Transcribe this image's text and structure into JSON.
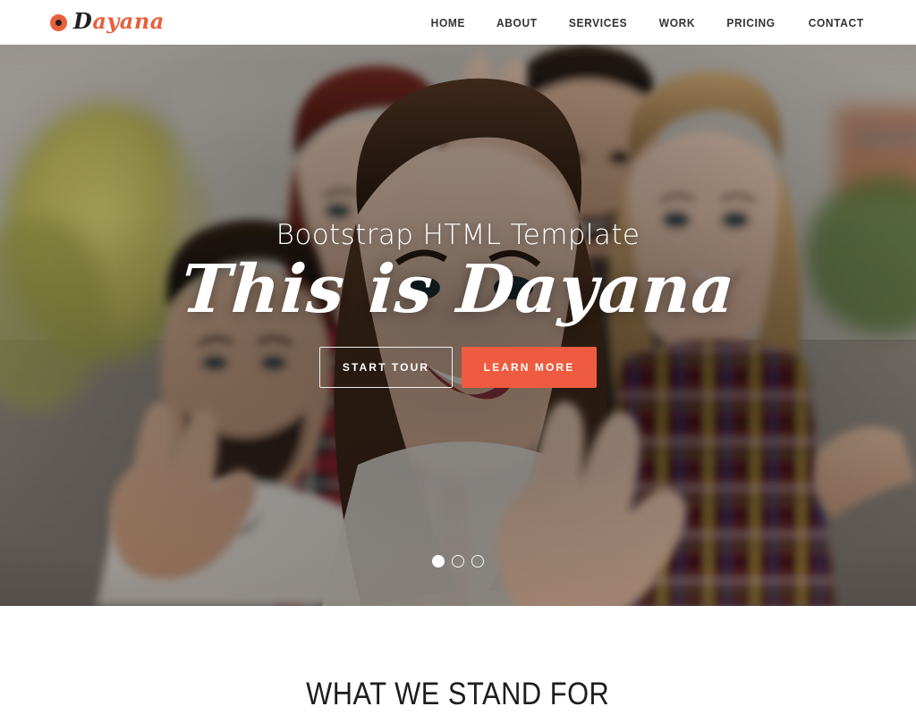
{
  "header": {
    "brand": {
      "mark_icon": "circle-dot-icon",
      "initial": "D",
      "rest": "ayana",
      "full_text": "Dayana"
    },
    "nav": {
      "items": [
        {
          "label": "HOME",
          "name": "nav-item-home"
        },
        {
          "label": "ABOUT",
          "name": "nav-item-about"
        },
        {
          "label": "SERVICES",
          "name": "nav-item-services"
        },
        {
          "label": "WORK",
          "name": "nav-item-work"
        },
        {
          "label": "PRICING",
          "name": "nav-item-pricing"
        },
        {
          "label": "CONTACT",
          "name": "nav-item-contact"
        }
      ]
    }
  },
  "hero": {
    "subtitle": "Bootstrap HTML Template",
    "title": "This is Dayana",
    "buttons": {
      "primary_outline": "START TOUR",
      "primary_solid": "LEARN MORE"
    },
    "carousel": {
      "slide_count": 3,
      "active_index": 0
    },
    "image_description": "Five smiling young people posing outdoors making peace-sign hand gestures"
  },
  "sections": {
    "stand_for": {
      "title": "WHAT WE STAND FOR"
    }
  },
  "colors": {
    "accent": "#ef5b40",
    "brand_mark": "#e8603c",
    "nav_text": "#333333",
    "heading_text": "#1d1d1d",
    "page_background": "#ffffff",
    "hero_text": "#ffffff"
  }
}
